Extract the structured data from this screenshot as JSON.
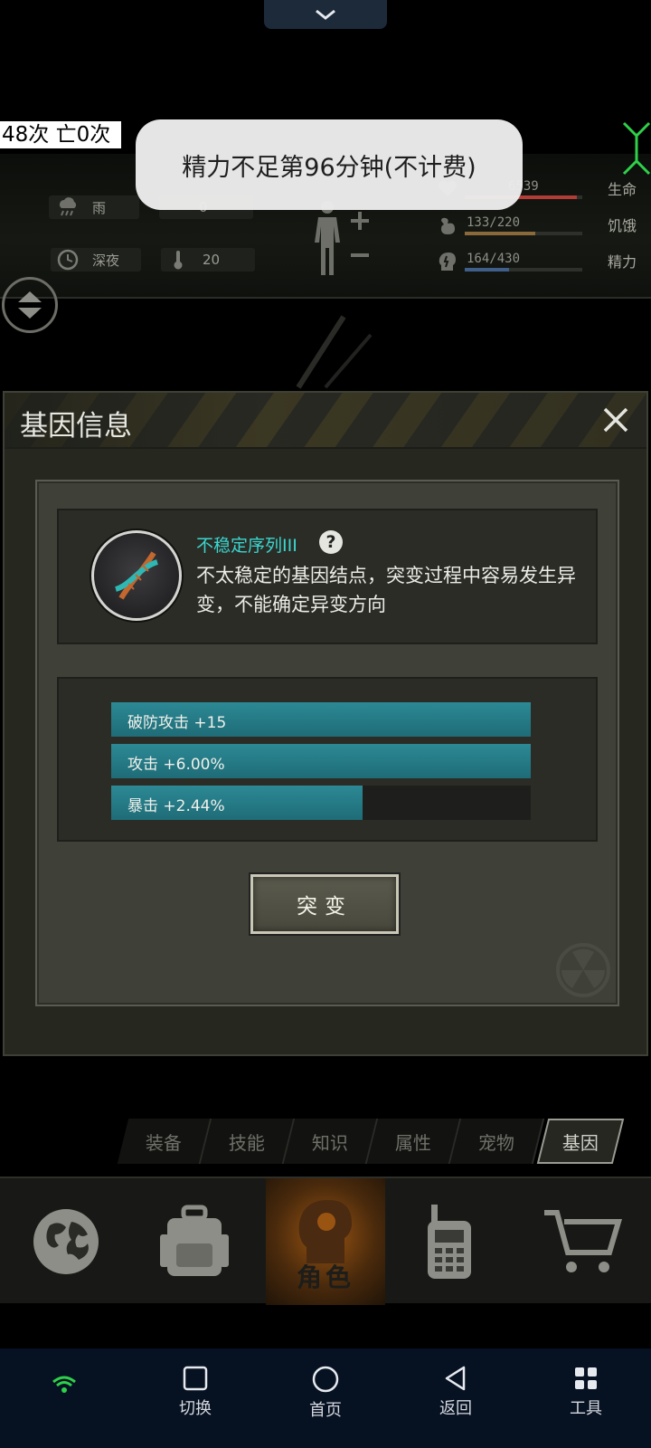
{
  "overlay": {
    "counter_text": "48次 亡0次",
    "toast_text": "精力不足第96分钟(不计费)"
  },
  "status": {
    "weather": "雨",
    "wind_value": "0",
    "time_of_day": "深夜",
    "temperature": "20",
    "vitals": [
      {
        "label": "生命",
        "value_text": "6539",
        "fill": 0.95,
        "color": "#b33b38"
      },
      {
        "label": "饥饿",
        "value_text": "133/220",
        "fill": 0.6,
        "color": "#8a6a3a"
      },
      {
        "label": "精力",
        "value_text": "164/430",
        "fill": 0.38,
        "color": "#3f5f8a"
      }
    ]
  },
  "modal": {
    "title": "基因信息",
    "gene": {
      "name": "不稳定序列III",
      "description": "不太稳定的基因结点，突变过程中容易发生异变，不能确定异变方向"
    },
    "attributes": [
      {
        "label": "破防攻击 +15",
        "fill": 1.0
      },
      {
        "label": "攻击 +6.00%",
        "fill": 1.0
      },
      {
        "label": "暴击 +2.44%",
        "fill": 0.6
      }
    ],
    "mutate_label": "突变"
  },
  "sub_tabs": [
    "装备",
    "技能",
    "知识",
    "属性",
    "宠物",
    "基因"
  ],
  "sub_tab_active": "基因",
  "main_nav": {
    "active_label": "角色",
    "items": [
      "world-icon",
      "backpack-icon",
      "character-icon",
      "radio-icon",
      "cart-icon"
    ]
  },
  "system_nav": {
    "switch": "切换",
    "home": "首页",
    "back": "返回",
    "tools": "工具"
  },
  "colors": {
    "accent_teal": "#3bd6d0",
    "bar_teal": "#2c8995",
    "nav_active": "#9a5412"
  }
}
